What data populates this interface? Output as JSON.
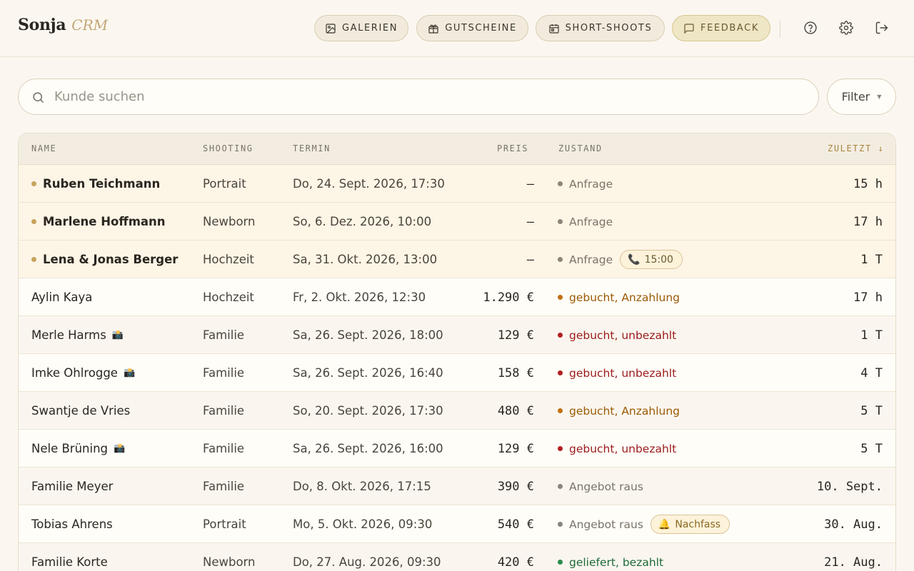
{
  "app": {
    "title": "Sonja",
    "subtitle": "CRM"
  },
  "nav": [
    {
      "label": "GALERIEN",
      "icon": "image-icon"
    },
    {
      "label": "GUTSCHEINE",
      "icon": "gift-icon"
    },
    {
      "label": "SHORT-SHOOTS",
      "icon": "calendar-icon"
    },
    {
      "label": "FEEDBACK",
      "icon": "message-icon"
    }
  ],
  "header_icons": [
    "help-icon",
    "settings-icon",
    "logout-icon"
  ],
  "search": {
    "placeholder": "Kunde suchen",
    "value": ""
  },
  "filter": {
    "label": "Filter"
  },
  "columns": {
    "name": "NAME",
    "shooting": "SHOOTING",
    "termin": "TERMIN",
    "preis": "PREIS",
    "zustand": "ZUSTAND",
    "zuletzt": "ZULETZT ↓"
  },
  "rows": [
    {
      "name": "Ruben Teichmann",
      "inquiry": true,
      "camera": false,
      "shooting": "Portrait",
      "termin": "Do, 24. Sept. 2026, 17:30",
      "preis": "—",
      "zustand": "Anfrage",
      "status": "grey",
      "chip": null,
      "zuletzt": "15 h"
    },
    {
      "name": "Marlene Hoffmann",
      "inquiry": true,
      "camera": false,
      "shooting": "Newborn",
      "termin": "So, 6. Dez. 2026, 10:00",
      "preis": "—",
      "zustand": "Anfrage",
      "status": "grey",
      "chip": null,
      "zuletzt": "17 h"
    },
    {
      "name": "Lena & Jonas Berger",
      "inquiry": true,
      "camera": false,
      "shooting": "Hochzeit",
      "termin": "Sa, 31. Okt. 2026, 13:00",
      "preis": "—",
      "zustand": "Anfrage",
      "status": "grey",
      "chip": {
        "icon": "📞",
        "text": "15:00",
        "kind": "call"
      },
      "zuletzt": "1 T"
    },
    {
      "name": "Aylin Kaya",
      "inquiry": false,
      "camera": false,
      "shooting": "Hochzeit",
      "termin": "Fr, 2. Okt. 2026, 12:30",
      "preis": "1.290 €",
      "zustand": "gebucht, Anzahlung",
      "status": "orange",
      "chip": null,
      "zuletzt": "17 h"
    },
    {
      "name": "Merle Harms",
      "inquiry": false,
      "camera": true,
      "shooting": "Familie",
      "termin": "Sa, 26. Sept. 2026, 18:00",
      "preis": "129 €",
      "zustand": "gebucht, unbezahlt",
      "status": "red",
      "chip": null,
      "zuletzt": "1 T"
    },
    {
      "name": "Imke Ohlrogge",
      "inquiry": false,
      "camera": true,
      "shooting": "Familie",
      "termin": "Sa, 26. Sept. 2026, 16:40",
      "preis": "158 €",
      "zustand": "gebucht, unbezahlt",
      "status": "red",
      "chip": null,
      "zuletzt": "4 T"
    },
    {
      "name": "Swantje de Vries",
      "inquiry": false,
      "camera": false,
      "shooting": "Familie",
      "termin": "So, 20. Sept. 2026, 17:30",
      "preis": "480 €",
      "zustand": "gebucht, Anzahlung",
      "status": "orange",
      "chip": null,
      "zuletzt": "5 T"
    },
    {
      "name": "Nele Brüning",
      "inquiry": false,
      "camera": true,
      "shooting": "Familie",
      "termin": "Sa, 26. Sept. 2026, 16:00",
      "preis": "129 €",
      "zustand": "gebucht, unbezahlt",
      "status": "red",
      "chip": null,
      "zuletzt": "5 T"
    },
    {
      "name": "Familie Meyer",
      "inquiry": false,
      "camera": false,
      "shooting": "Familie",
      "termin": "Do, 8. Okt. 2026, 17:15",
      "preis": "390 €",
      "zustand": "Angebot raus",
      "status": "grey",
      "chip": null,
      "zuletzt": "10. Sept."
    },
    {
      "name": "Tobias Ahrens",
      "inquiry": false,
      "camera": false,
      "shooting": "Portrait",
      "termin": "Mo, 5. Okt. 2026, 09:30",
      "preis": "540 €",
      "zustand": "Angebot raus",
      "status": "grey",
      "chip": {
        "icon": "🔔",
        "text": "Nachfass",
        "kind": "reminder"
      },
      "zuletzt": "30. Aug."
    },
    {
      "name": "Familie Korte",
      "inquiry": false,
      "camera": false,
      "shooting": "Newborn",
      "termin": "Do, 27. Aug. 2026, 09:30",
      "preis": "420 €",
      "zustand": "geliefert, bezahlt",
      "status": "green",
      "chip": null,
      "zuletzt": "21. Aug."
    }
  ],
  "colors": {
    "background": "#fbf7f0",
    "accent": "#c4a676",
    "status_orange": "#9a5a05",
    "status_red": "#9a1a1a",
    "status_green": "#1e6a3a",
    "status_grey": "#7a7468"
  }
}
